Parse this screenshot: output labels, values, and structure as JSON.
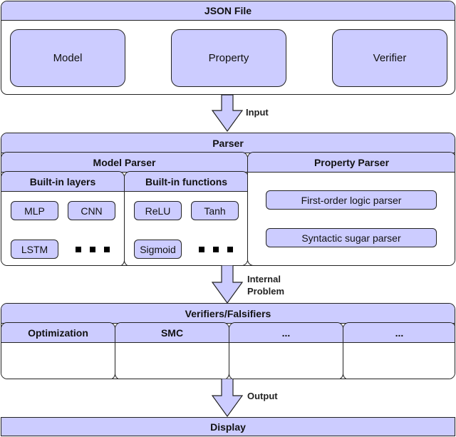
{
  "json_file": {
    "title": "JSON File",
    "items": [
      "Model",
      "Property",
      "Verifier"
    ]
  },
  "arrows": {
    "input": "Input",
    "internal_line1": "Internal",
    "internal_line2": "Problem",
    "output": "Output"
  },
  "parser": {
    "title": "Parser",
    "model_parser": {
      "title": "Model Parser",
      "layers": {
        "title": "Built-in layers",
        "items": [
          "MLP",
          "CNN",
          "LSTM"
        ]
      },
      "functions": {
        "title": "Built-in functions",
        "items": [
          "ReLU",
          "Tanh",
          "Sigmoid"
        ]
      }
    },
    "property_parser": {
      "title": "Property Parser",
      "items": [
        "First-order logic parser",
        "Syntactic sugar parser"
      ]
    }
  },
  "verifiers": {
    "title": "Verifiers/Falsifiers",
    "columns": [
      "Optimization",
      "SMC",
      "...",
      "..."
    ]
  },
  "display": {
    "title": "Display"
  },
  "colors": {
    "fill": "#ccccff",
    "stroke": "#222222"
  }
}
